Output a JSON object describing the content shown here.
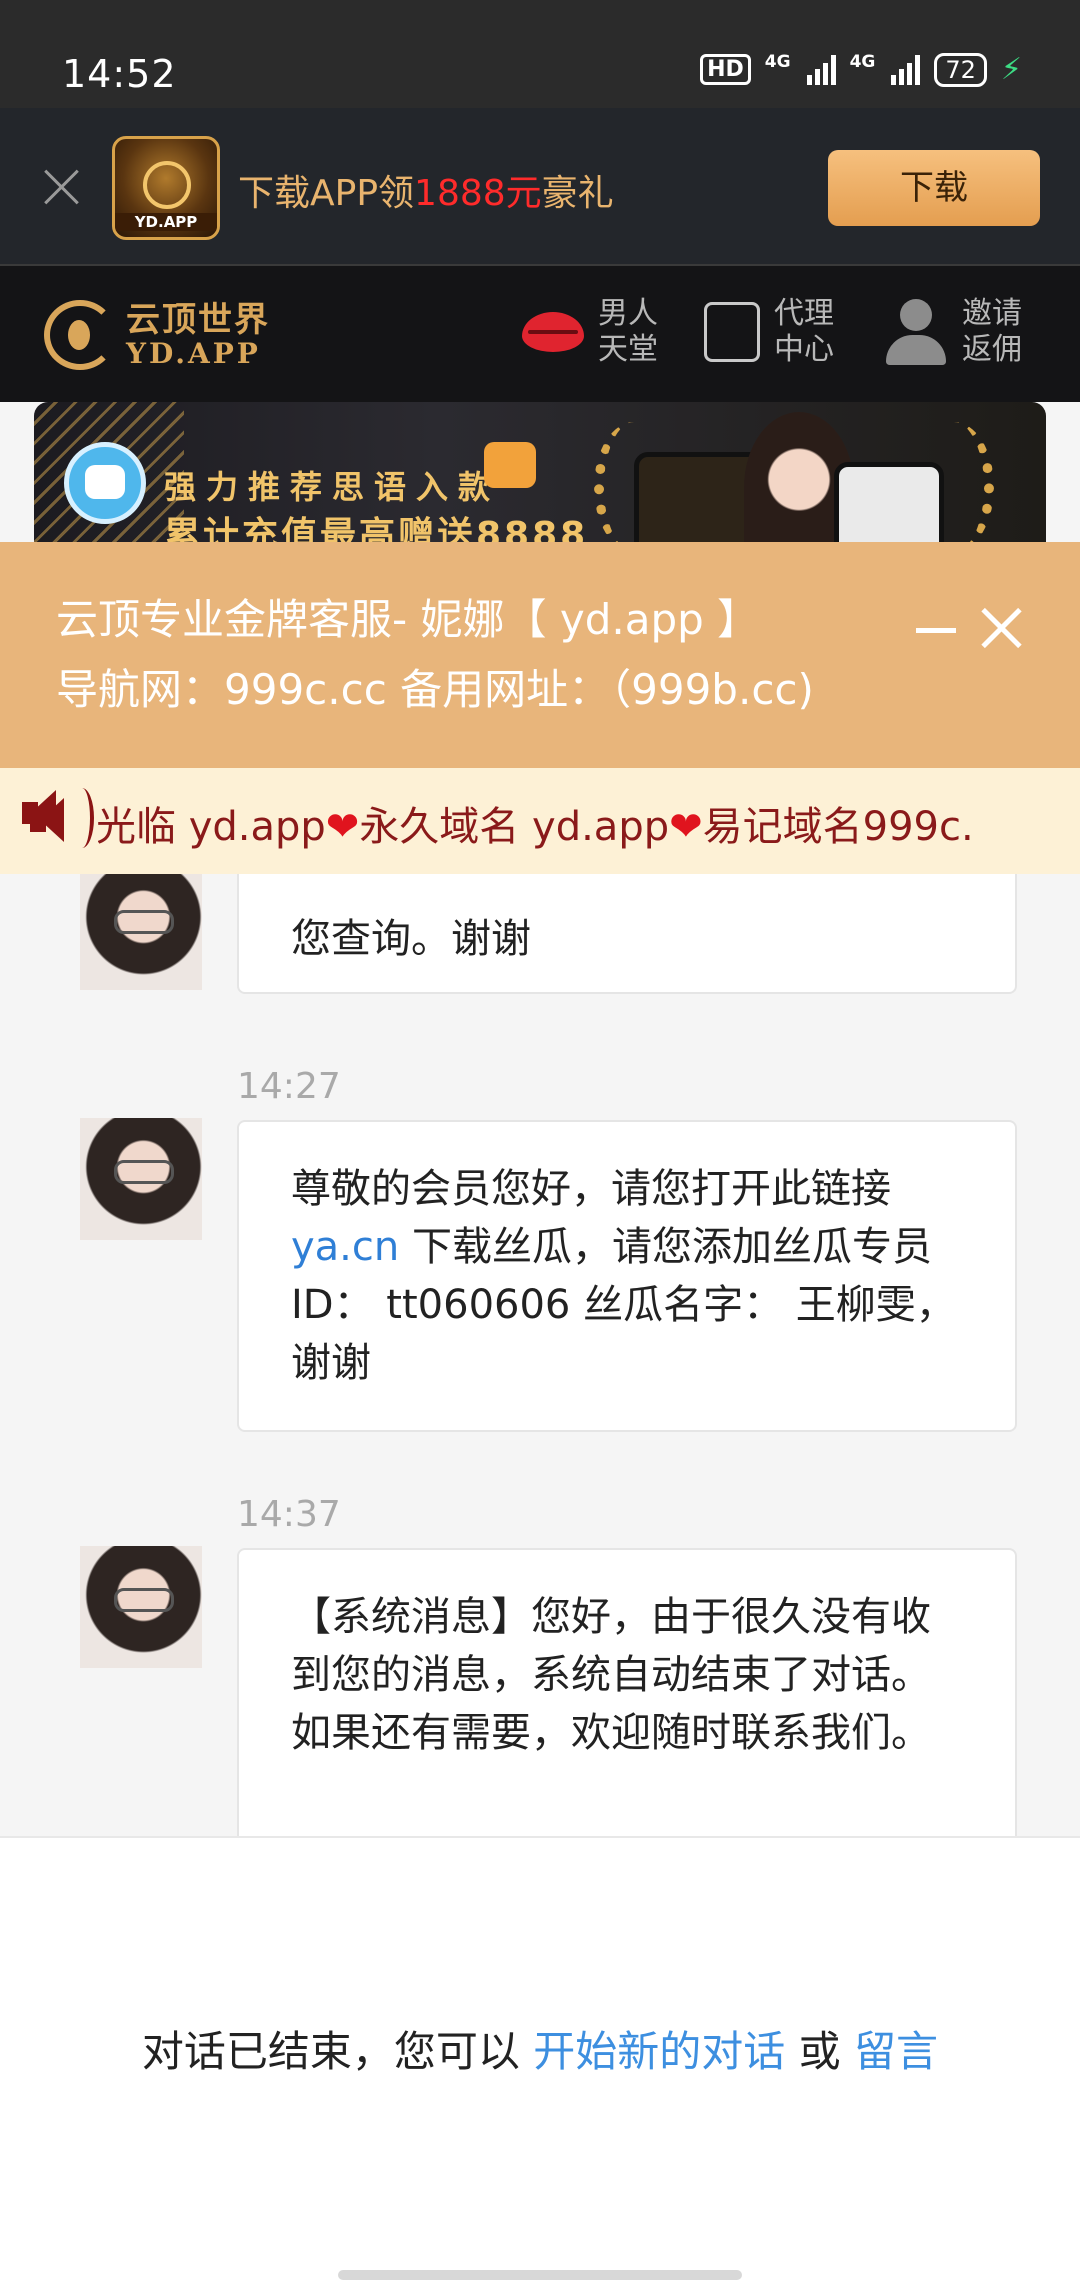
{
  "status_bar": {
    "time": "14:52",
    "hd_label": "HD",
    "sim1_label": "4G",
    "sim2_label": "4G",
    "battery": "72"
  },
  "download_banner": {
    "text_before": "下载APP领",
    "amount": "1888元",
    "text_after": "豪礼",
    "logo_text": "YD.APP",
    "button_label": "下载"
  },
  "site_header": {
    "logo_cn": "云顶世界",
    "logo_en": "YD.APP",
    "nav": [
      {
        "line1": "男人",
        "line2": "天堂",
        "icon": "lips-icon"
      },
      {
        "line1": "代理",
        "line2": "中心",
        "icon": "agent-icon"
      },
      {
        "line1": "邀请",
        "line2": "返佣",
        "icon": "user-icon"
      }
    ]
  },
  "promo_banner": {
    "line1": "强力推荐思语入款",
    "line2": "累计充值最高赠送8888"
  },
  "chat_header": {
    "title": "云顶专业金牌客服- 妮娜【 yd.app 】",
    "subtitle": "导航网：999c.cc 备用网址：（999b.cc)"
  },
  "marquee": {
    "seg1": "光临 yd.app",
    "heart": "❤",
    "seg2": "永久域名 yd.app",
    "seg3": "易记域名999c."
  },
  "messages": [
    {
      "text": "您查询。谢谢"
    },
    {
      "time": "14:27",
      "before_link": "尊敬的会员您好，请您打开此链接",
      "link": "ya.cn",
      "after_link": " 下载丝瓜，请您添加丝瓜专员ID： tt060606 丝瓜名字： 王柳雯， 谢谢"
    },
    {
      "time": "14:37",
      "text": "【系统消息】您好，由于很久没有收到您的消息，系统自动结束了对话。如果还有需要，欢迎随时联系我们。"
    }
  ],
  "footer": {
    "text": "对话已结束，您可以",
    "new_chat_link": "开始新的对话",
    "or": "或",
    "leave_message_link": "留言"
  },
  "colors": {
    "chat_header_bg": "#e8b57b",
    "marquee_bg": "#fdf1d6",
    "link_blue": "#2f7fd6",
    "download_button": "#e9a85f"
  }
}
